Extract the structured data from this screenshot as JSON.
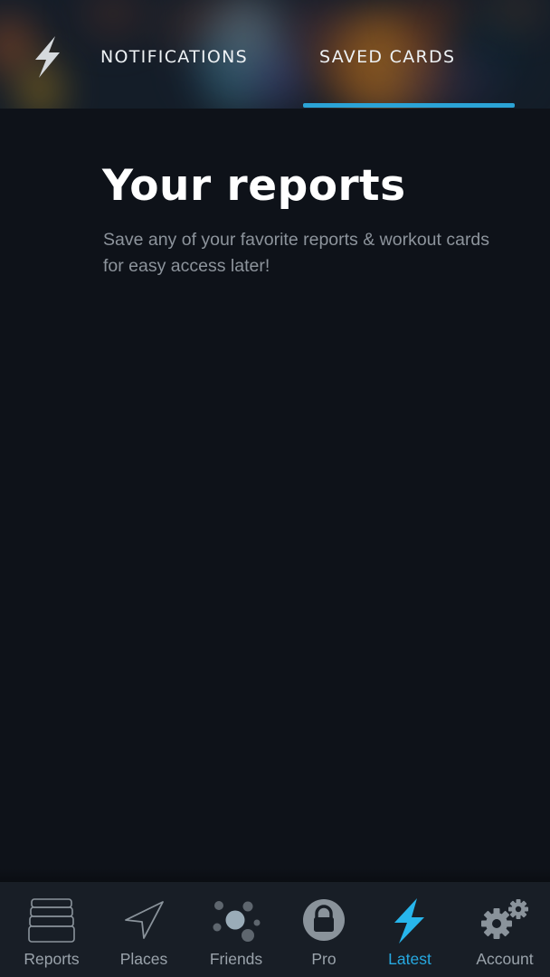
{
  "header": {
    "logo_icon": "lightning-bolt-icon",
    "tabs": [
      {
        "label": "NOTIFICATIONS",
        "active": false
      },
      {
        "label": "SAVED CARDS",
        "active": true
      }
    ]
  },
  "main": {
    "title": "Your reports",
    "subtitle": "Save any of your favorite reports & workout cards for easy access later!"
  },
  "bottom_nav": {
    "items": [
      {
        "label": "Reports",
        "icon": "stacked-cards-icon",
        "active": false
      },
      {
        "label": "Places",
        "icon": "navigation-arrow-icon",
        "active": false
      },
      {
        "label": "Friends",
        "icon": "friends-dots-icon",
        "active": false
      },
      {
        "label": "Pro",
        "icon": "lock-icon",
        "active": false
      },
      {
        "label": "Latest",
        "icon": "lightning-bolt-icon",
        "active": true
      },
      {
        "label": "Account",
        "icon": "gears-icon",
        "active": false
      }
    ]
  },
  "colors": {
    "accent": "#27a9e1",
    "tab_indicator": "#2ba3d6",
    "background": "#0e1219",
    "nav_background": "#181e26",
    "inactive_icon": "#8a939b"
  }
}
